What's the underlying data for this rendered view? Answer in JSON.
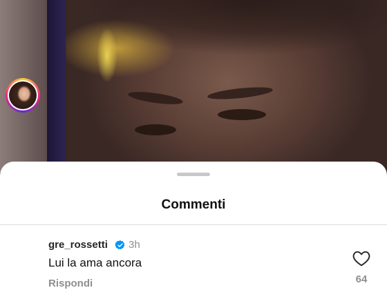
{
  "sheet": {
    "title": "Commenti"
  },
  "comment": {
    "username": "gre_rossetti",
    "verified": true,
    "time": "3h",
    "text": "Lui la ama ancora",
    "reply_label": "Rispondi",
    "likes": "64"
  },
  "icons": {
    "verified": "verified-badge-icon",
    "like": "heart-icon"
  },
  "colors": {
    "verified_blue": "#0095f6",
    "secondary_text": "#8e8e8e"
  }
}
